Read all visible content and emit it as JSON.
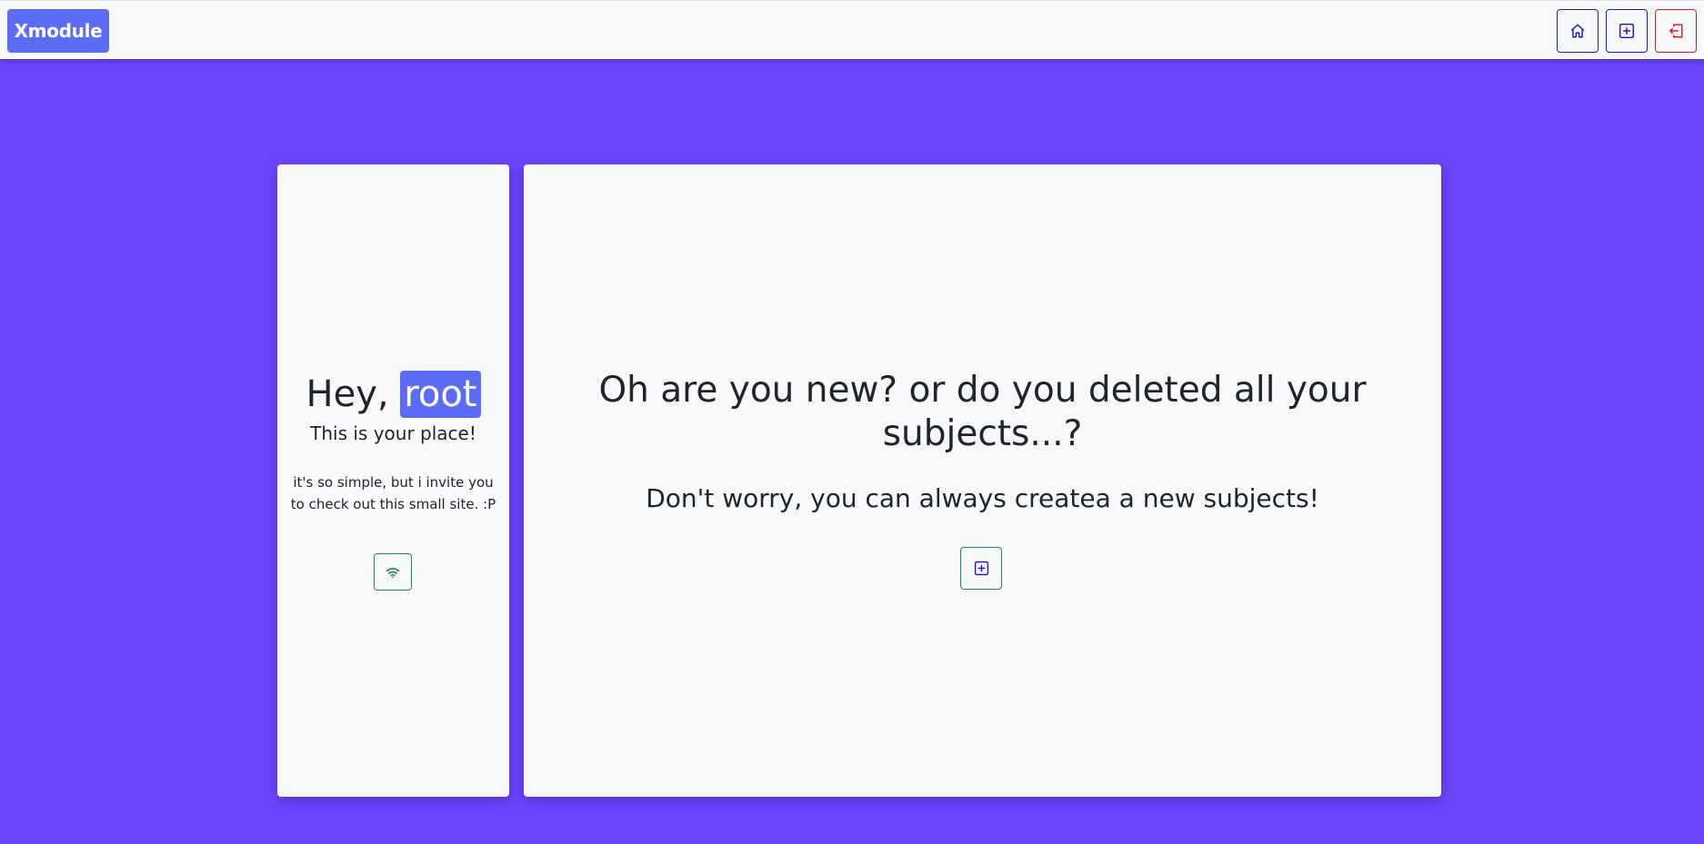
{
  "navbar": {
    "brand": "Xmodule",
    "buttons": [
      {
        "icon": "house-icon",
        "color": "#1d14d6"
      },
      {
        "icon": "plus-square-icon",
        "color": "#1d14d6"
      },
      {
        "icon": "box-arrow-left-icon",
        "color": "#e3141c"
      }
    ]
  },
  "profile": {
    "greeting_prefix": "Hey,",
    "username": "root",
    "tagline": "This is your place!",
    "description": "it's so simple, but i invite you to check out this small site. :P",
    "button_icon": "wifi-icon"
  },
  "empty_state": {
    "headline": "Oh are you new? or do you deleted all your subjects...?",
    "message": "Don't worry, you can always createa a new subjects!",
    "button_icon": "plus-square-icon"
  },
  "colors": {
    "background": "#6d44fe",
    "accent": "#5b6cf6",
    "primary_outline": "#1d14d6",
    "danger_outline": "#e3141c",
    "success_outline": "#198754",
    "card": "#f8f9fa"
  }
}
